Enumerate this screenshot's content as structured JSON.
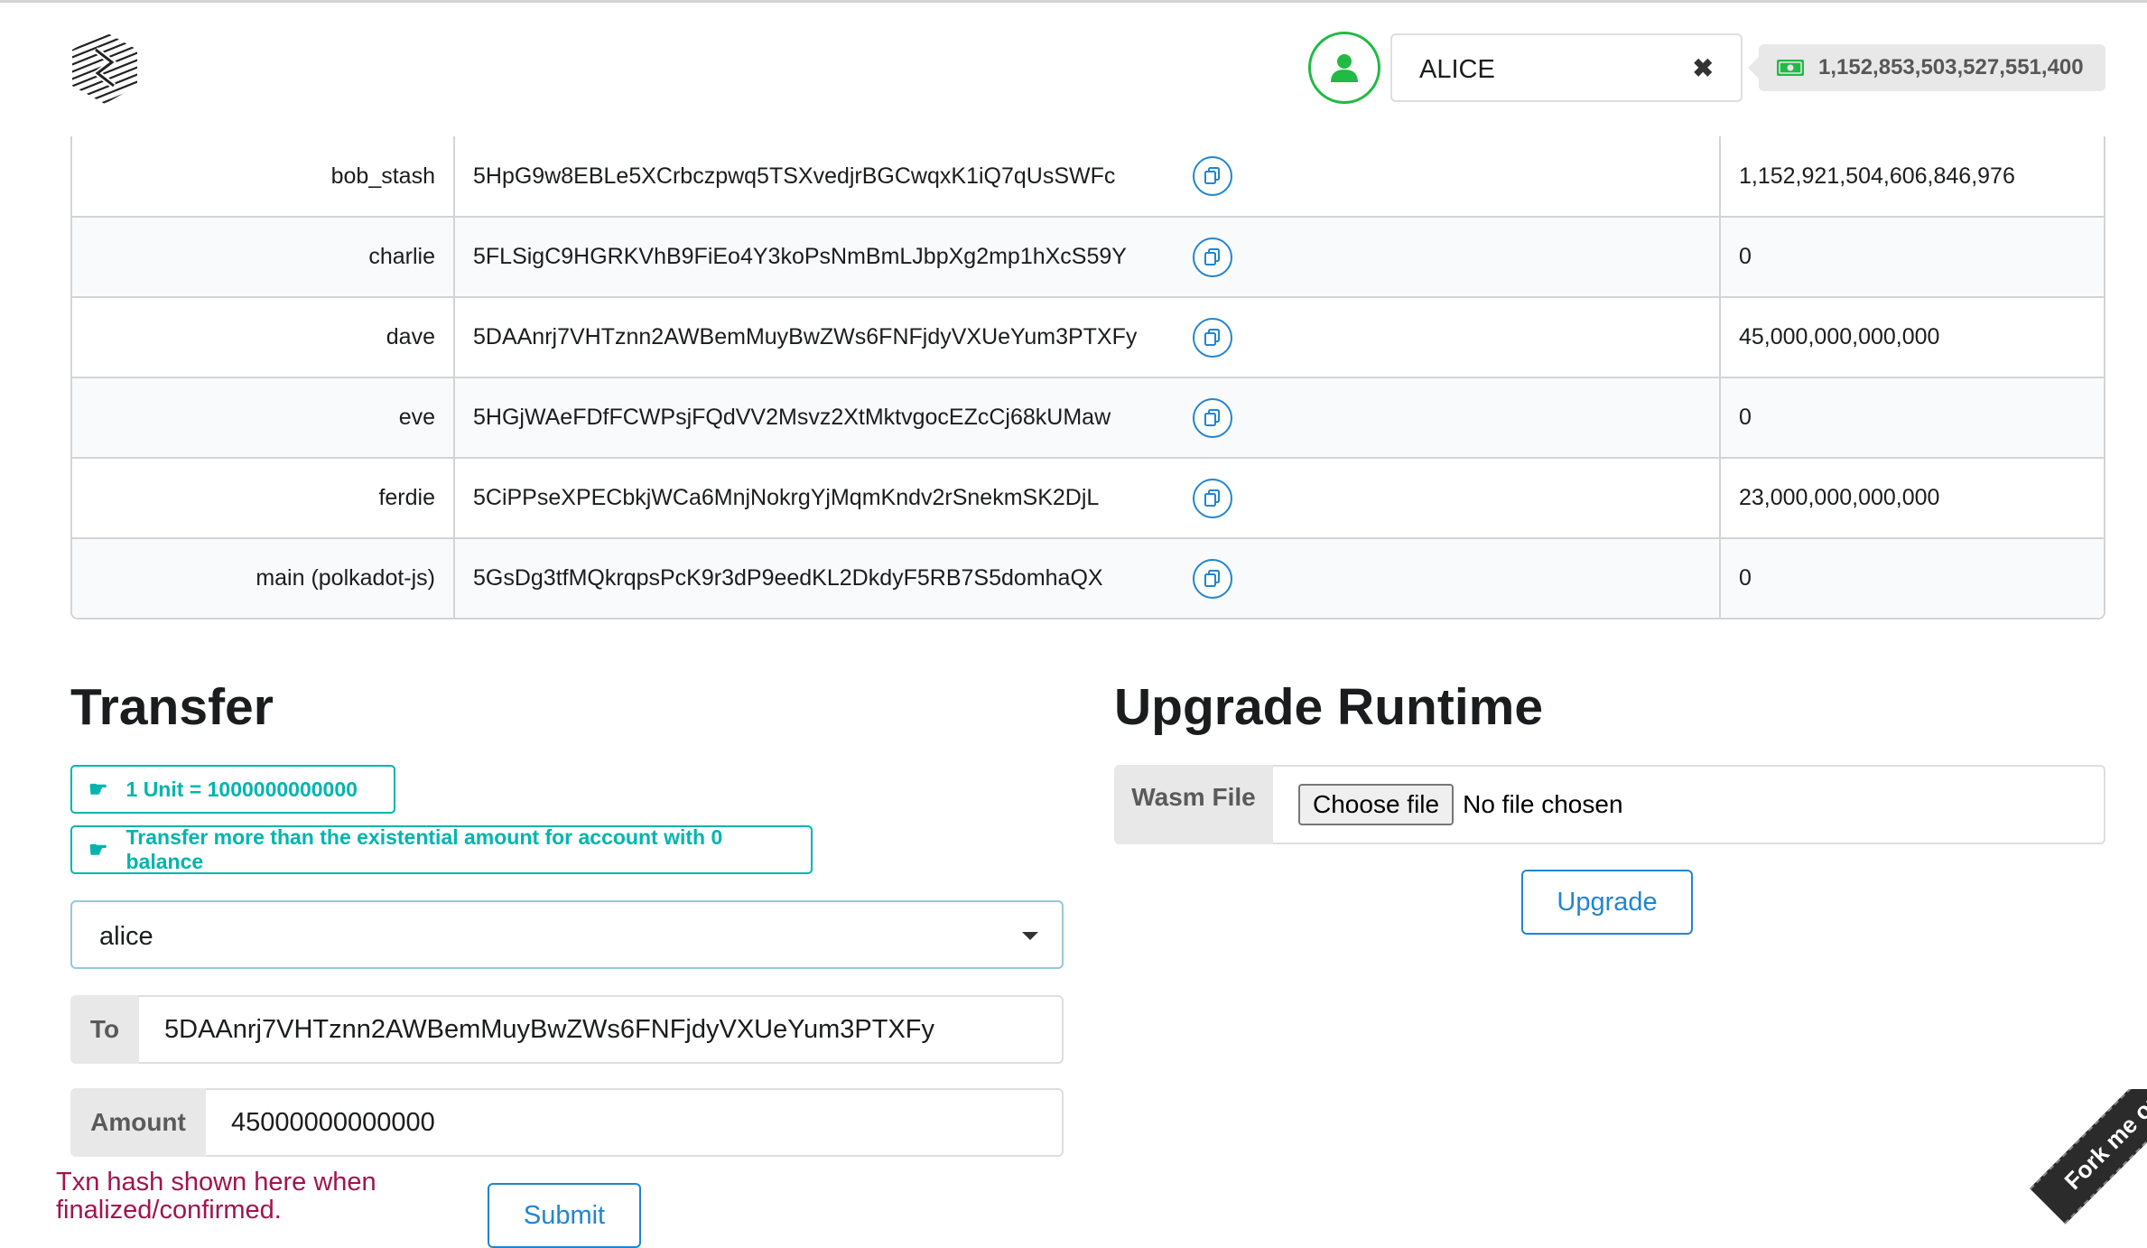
{
  "header": {
    "account_name": "ALICE",
    "clear_glyph": "✖",
    "balance": "1,152,853,503,527,551,400",
    "logo_icon": "substrate-logo-icon",
    "user_icon": "user-icon",
    "money_icon": "money-bill-icon"
  },
  "accounts_table": {
    "rows": [
      {
        "name": "bob_stash",
        "address": "5HpG9w8EBLe5XCrbczpwq5TSXvedjrBGCwqxK1iQ7qUsSWFc",
        "balance": "1,152,921,504,606,846,976"
      },
      {
        "name": "charlie",
        "address": "5FLSigC9HGRKVhB9FiEo4Y3koPsNmBmLJbpXg2mp1hXcS59Y",
        "balance": "0"
      },
      {
        "name": "dave",
        "address": "5DAAnrj7VHTznn2AWBemMuyBwZWs6FNFjdyVXUeYum3PTXFy",
        "balance": "45,000,000,000,000"
      },
      {
        "name": "eve",
        "address": "5HGjWAeFDfFCWPsjFQdVV2Msvz2XtMktvgocEZcCj68kUMaw",
        "balance": "0"
      },
      {
        "name": "ferdie",
        "address": "5CiPPseXPECbkjWCa6MnjNokrgYjMqmKndv2rSnekmSK2DjL",
        "balance": "23,000,000,000,000"
      },
      {
        "name": "main (polkadot-js)",
        "address": "5GsDg3tfMQkrqpsPcK9r3dP9eedKL2DkdyF5RB7S5domhaQX",
        "balance": "0"
      }
    ]
  },
  "transfer": {
    "title": "Transfer",
    "note_unit": "1 Unit = 1000000000000",
    "note_existential": "Transfer more than the existential amount for account with 0 balance",
    "from_account": "alice",
    "to_label": "To",
    "to_value": "5DAAnrj7VHTznn2AWBemMuyBwZWs6FNFjdyVXUeYum3PTXFy",
    "amount_label": "Amount",
    "amount_value": "45000000000000",
    "status_text": "Txn hash shown here when finalized/confirmed.",
    "submit_label": "Submit"
  },
  "upgrade": {
    "title": "Upgrade Runtime",
    "wasm_label": "Wasm File",
    "choose_file_label": "Choose file",
    "no_file_text": "No file chosen",
    "upgrade_label": "Upgrade"
  },
  "fork_ribbon": {
    "text": "Fork me on GitHub"
  }
}
